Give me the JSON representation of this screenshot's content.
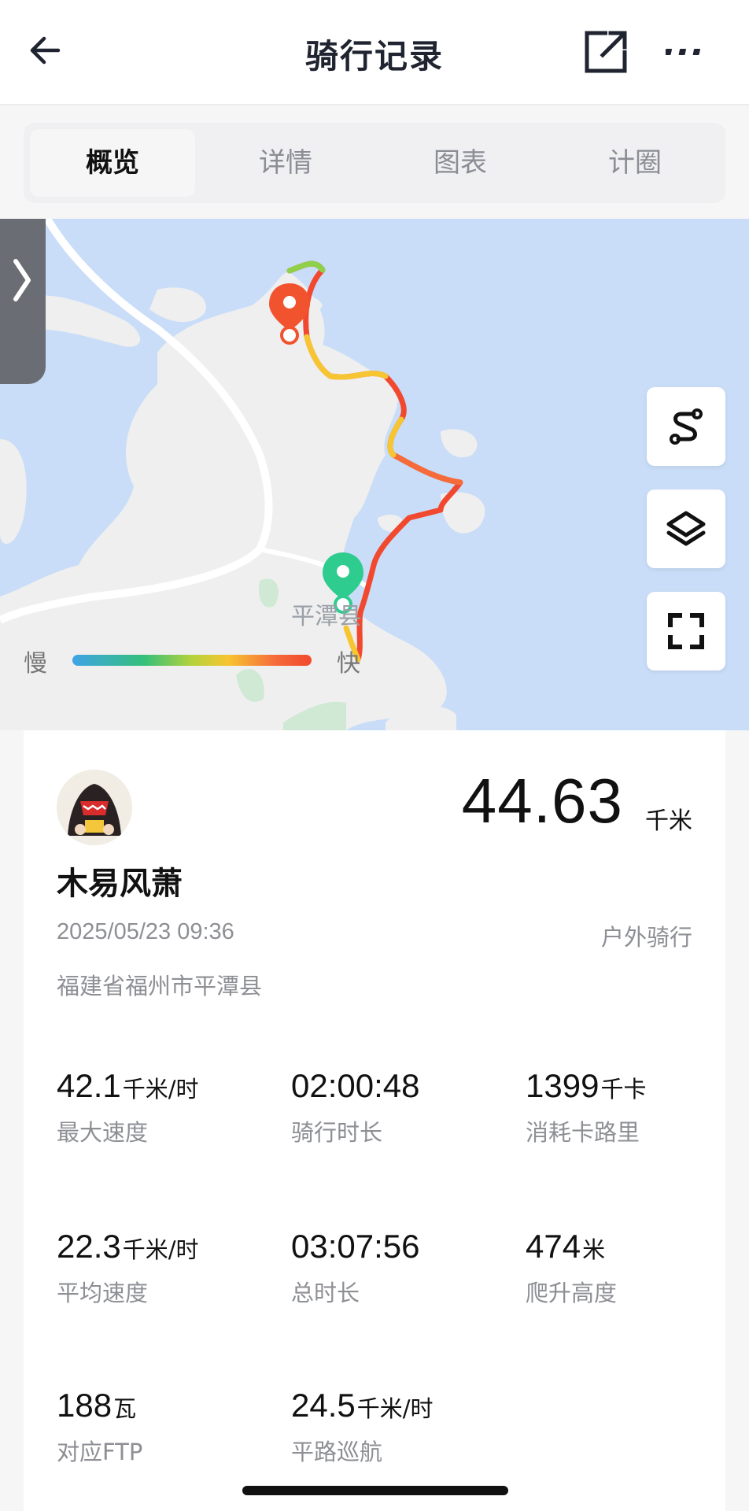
{
  "header": {
    "title": "骑行记录",
    "back_icon": "back-arrow-icon",
    "share_icon": "share-edit-icon",
    "more_icon": "more-dots-icon"
  },
  "tabs": [
    {
      "label": "概览",
      "active": true
    },
    {
      "label": "详情",
      "active": false
    },
    {
      "label": "图表",
      "active": false
    },
    {
      "label": "计圈",
      "active": false
    }
  ],
  "map": {
    "city_label": "平潭县",
    "legend": {
      "slow": "慢",
      "fast": "快"
    },
    "side_handle_icon": "chevron-right-icon",
    "buttons": [
      "route-icon",
      "layers-icon",
      "fullscreen-icon"
    ],
    "colors": {
      "water": "#c9ddf8",
      "land": "#efefef",
      "start": "#2ecc8f",
      "end": "#f2532f"
    }
  },
  "summary": {
    "distance": "44.63",
    "distance_unit": "千米",
    "username": "木易风萧",
    "datetime": "2025/05/23 09:36",
    "activity_type": "户外骑行",
    "location": "福建省福州市平潭县"
  },
  "stats": [
    {
      "value": "42.1",
      "unit": "千米/时",
      "label": "最大速度"
    },
    {
      "value": "02:00:48",
      "unit": "",
      "label": "骑行时长"
    },
    {
      "value": "1399",
      "unit": "千卡",
      "label": "消耗卡路里"
    },
    {
      "value": "22.3",
      "unit": "千米/时",
      "label": "平均速度"
    },
    {
      "value": "03:07:56",
      "unit": "",
      "label": "总时长"
    },
    {
      "value": "474",
      "unit": "米",
      "label": "爬升高度"
    },
    {
      "value": "188",
      "unit": "瓦",
      "label": "对应FTP"
    },
    {
      "value": "24.5",
      "unit": "千米/时",
      "label": "平路巡航"
    }
  ]
}
